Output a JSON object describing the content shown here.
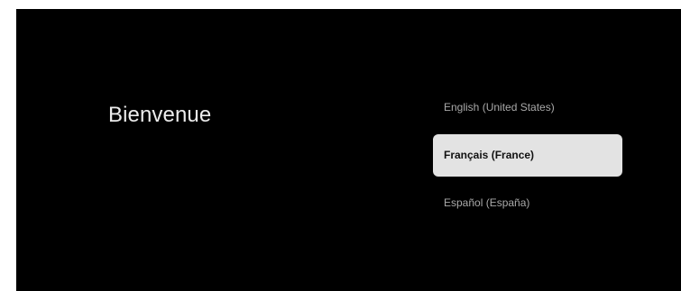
{
  "welcome": {
    "title": "Bienvenue"
  },
  "languages": {
    "items": [
      {
        "label": "English (United States)",
        "selected": false
      },
      {
        "label": "Français (France)",
        "selected": true
      },
      {
        "label": "Español (España)",
        "selected": false
      }
    ]
  },
  "colors": {
    "background": "#000000",
    "text": "#ececec",
    "muted_text": "#a9a9a9",
    "selected_bg": "#e3e3e3",
    "selected_text": "#111111"
  }
}
